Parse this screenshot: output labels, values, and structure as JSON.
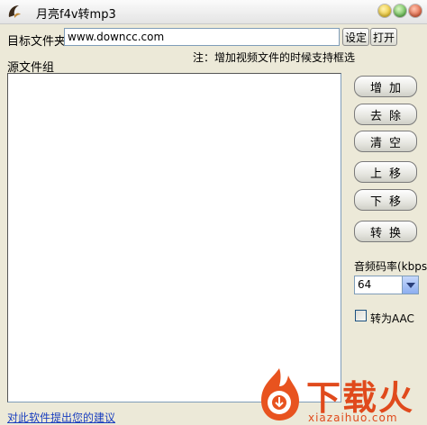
{
  "window": {
    "title": "月亮f4v转mp3"
  },
  "target": {
    "label": "目标文件夹",
    "value": "www.downcc.com",
    "settings_label": "设定",
    "open_label": "打开"
  },
  "hint": "注：增加视频文件的时候支持框选",
  "source": {
    "label": "源文件组"
  },
  "buttons": {
    "add": "增加",
    "remove": "去除",
    "clear": "清空",
    "move_up": "上移",
    "move_down": "下移",
    "convert": "转换"
  },
  "bitrate": {
    "label": "音频码率(kbps)",
    "value": "64"
  },
  "aac": {
    "label": "转为AAC",
    "checked": false
  },
  "feedback_link": "对此软件提出您的建议",
  "watermark": {
    "text": "下载火",
    "url": "xiazaihuo.com"
  },
  "colors": {
    "window_bg": "#ece9d8",
    "link": "#1a3fbf",
    "watermark": "#e04a1c"
  }
}
